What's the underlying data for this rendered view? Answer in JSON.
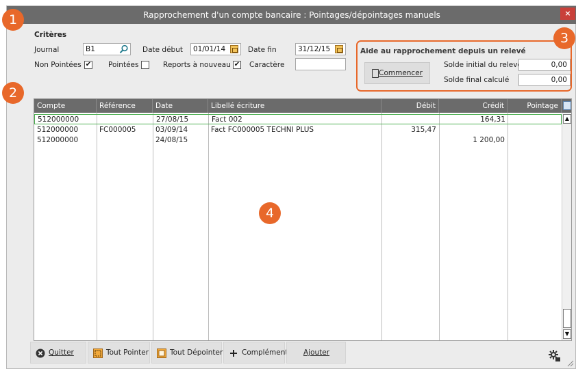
{
  "window": {
    "title": "Rapprochement d'un compte bancaire : Pointages/dépointages manuels",
    "close": "×"
  },
  "badges": [
    "1",
    "2",
    "3",
    "4"
  ],
  "criteres": {
    "heading": "Critères",
    "journal_label": "Journal",
    "journal_value": "B1",
    "date_debut_label": "Date début",
    "date_debut_value": "01/01/14",
    "date_fin_label": "Date fin",
    "date_fin_value": "31/12/15",
    "non_pointees_label": "Non Pointées",
    "non_pointees_checked": "✔",
    "pointees_label": "Pointées",
    "reports_label": "Reports à nouveau",
    "reports_checked": "✔",
    "caractere_label": "Caractère",
    "caractere_value": ""
  },
  "aide": {
    "heading": "Aide au rapprochement depuis un relevé",
    "commencer": "Commencer",
    "solde_initial_label": "Solde initial du relevé",
    "solde_initial_value": "0,00",
    "solde_final_label": "Solde final calculé",
    "solde_final_value": "0,00"
  },
  "grid": {
    "columns": [
      "Compte",
      "Référence",
      "Date",
      "Libellé écriture",
      "Débit",
      "Crédit",
      "Pointage"
    ],
    "rows": [
      {
        "compte": "512000000",
        "reference": "",
        "date": "27/08/15",
        "libelle": "Fact 002",
        "debit": "",
        "credit": "164,31",
        "pointage": ""
      },
      {
        "compte": "512000000",
        "reference": "FC000005",
        "date": "03/09/14",
        "libelle": "Fact FC000005 TECHNI PLUS",
        "debit": "315,47",
        "credit": "",
        "pointage": ""
      },
      {
        "compte": "512000000",
        "reference": "",
        "date": "24/08/15",
        "libelle": "",
        "debit": "",
        "credit": "1 200,00",
        "pointage": ""
      }
    ]
  },
  "toolbar": {
    "quitter": "Quitter",
    "tout_pointer": "Tout Pointer",
    "tout_depointer": "Tout Dépointer",
    "complement": "Complément",
    "ajouter": "Ajouter"
  },
  "colors": {
    "accent": "#e8682a",
    "header": "#6b6b6b",
    "selection": "#4caf50"
  }
}
